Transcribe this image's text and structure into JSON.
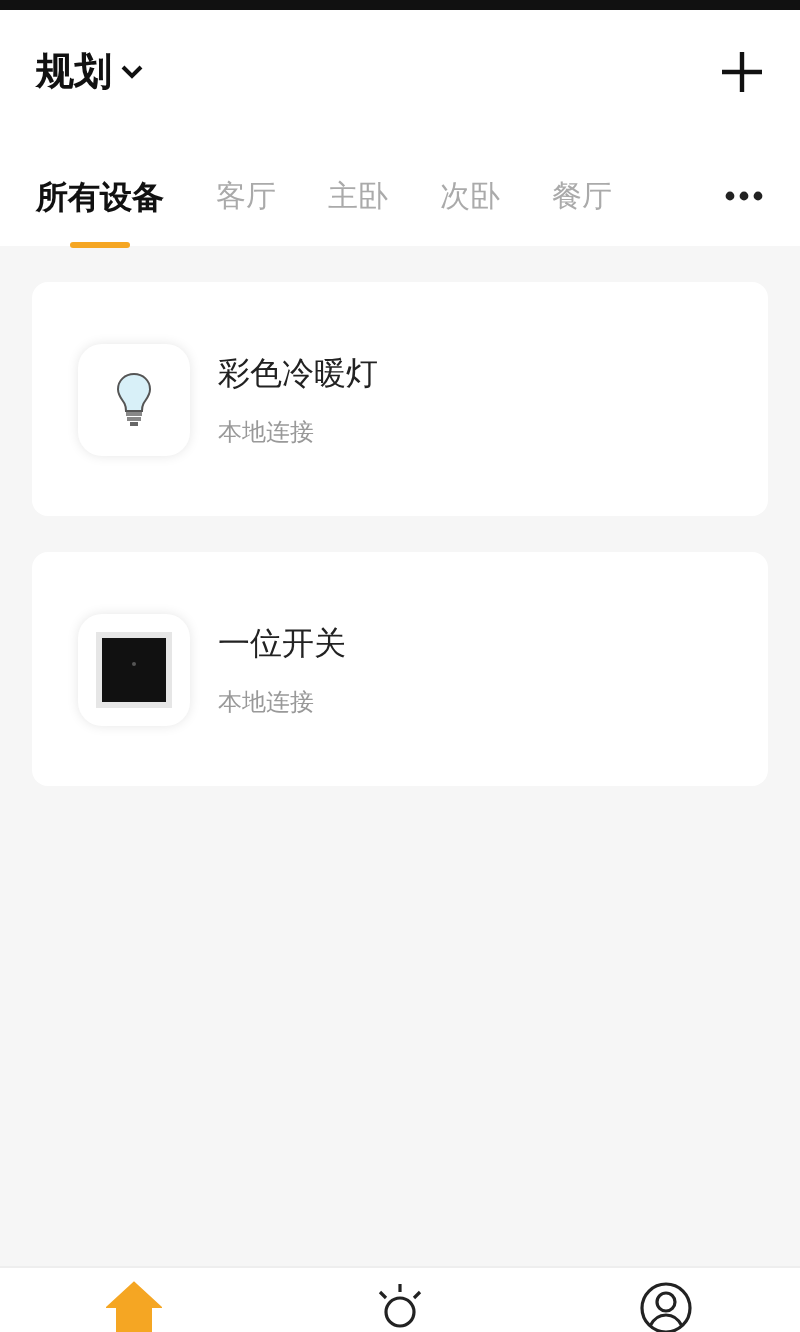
{
  "header": {
    "title": "规划"
  },
  "tabs": [
    {
      "label": "所有设备",
      "selected": true
    },
    {
      "label": "客厅",
      "selected": false
    },
    {
      "label": "主卧",
      "selected": false
    },
    {
      "label": "次卧",
      "selected": false
    },
    {
      "label": "餐厅",
      "selected": false
    }
  ],
  "devices": [
    {
      "name": "彩色冷暖灯",
      "status": "本地连接",
      "kind": "bulb"
    },
    {
      "name": "一位开关",
      "status": "本地连接",
      "kind": "switch"
    }
  ],
  "bottom_nav": [
    {
      "kind": "home",
      "selected": true
    },
    {
      "kind": "scene",
      "selected": false
    },
    {
      "kind": "profile",
      "selected": false
    }
  ]
}
